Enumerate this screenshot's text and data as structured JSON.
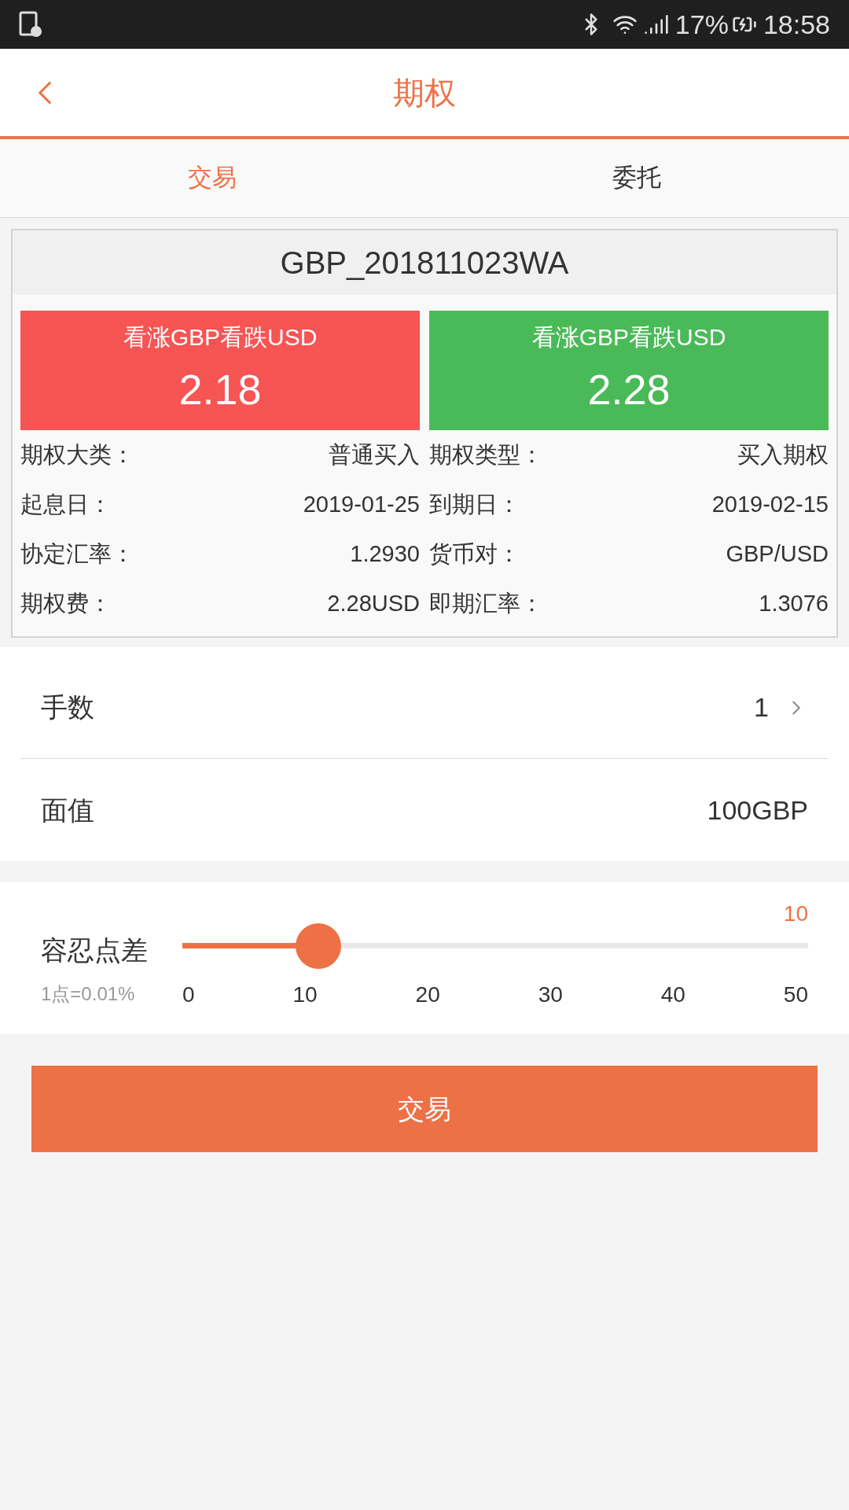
{
  "status_bar": {
    "battery": "17%",
    "time": "18:58"
  },
  "header": {
    "title": "期权"
  },
  "tabs": [
    {
      "label": "交易",
      "selected": true
    },
    {
      "label": "委托",
      "selected": false
    }
  ],
  "contract": {
    "code": "GBP_201811023WA",
    "quotes": [
      {
        "label": "看涨GBP看跌USD",
        "price": "2.18",
        "color": "#f75454"
      },
      {
        "label": "看涨GBP看跌USD",
        "price": "2.28",
        "color": "#4aba58"
      }
    ],
    "details": [
      {
        "label": "期权大类：",
        "value": "普通买入"
      },
      {
        "label": "期权类型：",
        "value": "买入期权"
      },
      {
        "label": "起息日：",
        "value": "2019-01-25"
      },
      {
        "label": "到期日：",
        "value": "2019-02-15"
      },
      {
        "label": "协定汇率：",
        "value": "1.2930"
      },
      {
        "label": "货币对：",
        "value": "GBP/USD"
      },
      {
        "label": "期权费：",
        "value": "2.28USD"
      },
      {
        "label": "即期汇率：",
        "value": "1.3076"
      }
    ]
  },
  "lots": {
    "label": "手数",
    "value": "1"
  },
  "face_value": {
    "label": "面值",
    "value": "100GBP"
  },
  "tolerance": {
    "label": "容忍点差",
    "hint": "1点=0.01%",
    "reading": "10",
    "level": 0.2,
    "ticks": [
      "0",
      "10",
      "20",
      "30",
      "40",
      "50"
    ]
  },
  "submit": "交易"
}
